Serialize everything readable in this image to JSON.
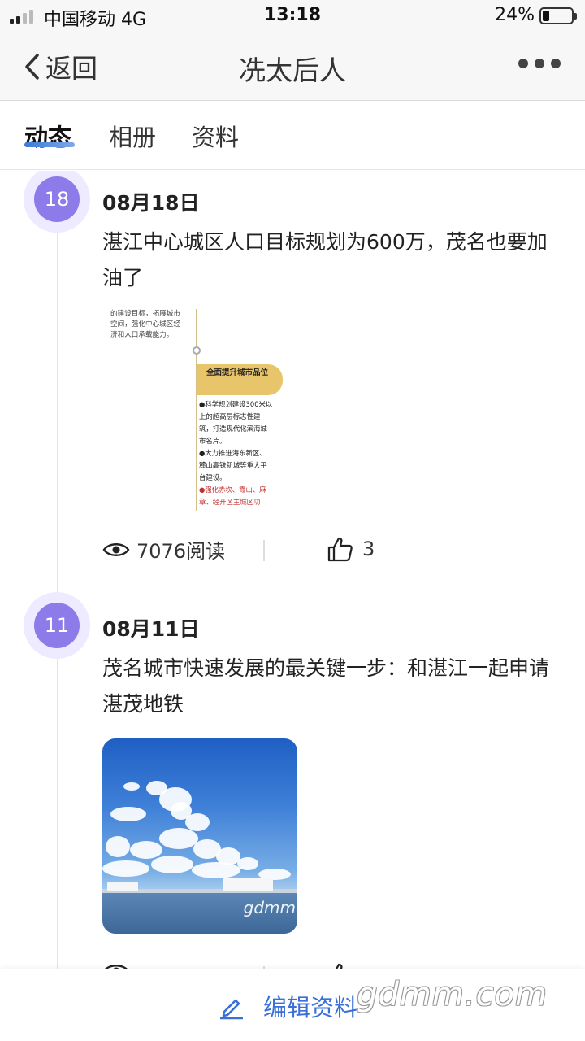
{
  "status_bar": {
    "carrier": "中国移动  4G",
    "time": "13:18",
    "battery": "24%",
    "battery_level": 0.24,
    "signal_bars": 2
  },
  "nav": {
    "back_label": "返回",
    "title": "冼太后人",
    "more_icon": "more-dots-icon"
  },
  "tabs": [
    {
      "label": "动态",
      "active": true
    },
    {
      "label": "相册",
      "active": false
    },
    {
      "label": "资料",
      "active": false
    }
  ],
  "posts": [
    {
      "day": "18",
      "date": "08月18日",
      "text": [
        "湛江中心城区人口目标规划为600万，茂名也要加",
        "油了"
      ],
      "image": {
        "top_text": [
          "的建设目标，拓展城市",
          "空间，强化中心城区经",
          "济和人口承载能力。"
        ],
        "pill": "全面提升城市品位",
        "body": [
          "●科学规划建设300米以",
          "上的超高层标志性建",
          "筑，打造现代化滨海城",
          "市名片。",
          "●大力推进海东新区、",
          "麓山高铁新城等重大平",
          "台建设。"
        ],
        "body_red": [
          "●强化赤坎、霞山、麻",
          "章、经开区主城区功"
        ]
      },
      "views": "7076阅读",
      "likes": "3"
    },
    {
      "day": "11",
      "date": "08月11日",
      "text": [
        "茂名城市快速发展的最关键一步：和湛江一起申请",
        "湛茂地铁"
      ],
      "image_watermark": "gdmm",
      "views": "",
      "likes": ""
    }
  ],
  "bottom": {
    "edit_label": "编辑资料",
    "watermark": "gdmm.com"
  },
  "colors": {
    "accent": "#3a6fd8",
    "badge": "#8c7be8",
    "badge_ring": "#eeeaff"
  }
}
